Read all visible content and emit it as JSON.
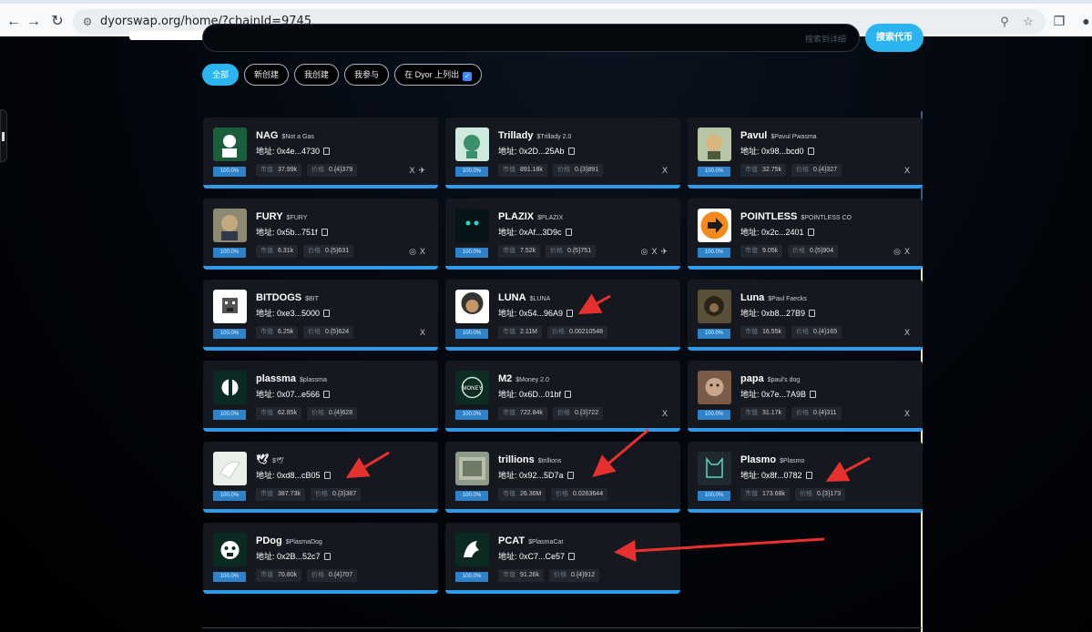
{
  "browser": {
    "url": "dyorswap.org/home/?chainId=9745"
  },
  "search": {
    "placeholder": "搜索到详细",
    "button_label": "搜索代币"
  },
  "filters": [
    {
      "label": "全部",
      "active": true
    },
    {
      "label": "新创建",
      "active": false
    },
    {
      "label": "我创建",
      "active": false
    },
    {
      "label": "我参与",
      "active": false
    },
    {
      "label": "在 Dyor 上列出",
      "active": false,
      "checked": true
    }
  ],
  "labels": {
    "address_prefix": "地址: ",
    "market_cap": "市值",
    "price": "价格"
  },
  "tokens": [
    {
      "name": "NAG",
      "ticker": "$Not a Gas",
      "address": "0x4e...4730",
      "progress": "100.0%",
      "market_cap": "37.99k",
      "price": "0.{4}379",
      "socials": [
        "x",
        "telegram"
      ]
    },
    {
      "name": "Trillady",
      "ticker": "$Trillady 2.0",
      "address": "0x2D...25Ab",
      "progress": "100.0%",
      "market_cap": "891.18k",
      "price": "0.{3}891",
      "socials": [
        "x"
      ]
    },
    {
      "name": "Pavul",
      "ticker": "$Pavul Pwasma",
      "address": "0x98...bcd0",
      "progress": "100.0%",
      "market_cap": "32.75k",
      "price": "0.{4}327",
      "socials": [
        "x"
      ]
    },
    {
      "name": "FURY",
      "ticker": "$FURY",
      "address": "0x5b...751f",
      "progress": "100.0%",
      "market_cap": "6.31k",
      "price": "0.{5}631",
      "socials": [
        "web",
        "x"
      ]
    },
    {
      "name": "PLAZIX",
      "ticker": "$PLAZIX",
      "address": "0xAf...3D9c",
      "progress": "100.0%",
      "market_cap": "7.52k",
      "price": "0.{5}751",
      "socials": [
        "web",
        "x",
        "telegram"
      ]
    },
    {
      "name": "POINTLESS",
      "ticker": "$POINTLESS CO",
      "address": "0x2c...2401",
      "progress": "100.0%",
      "market_cap": "9.05k",
      "price": "0.{5}904",
      "socials": [
        "web",
        "x"
      ]
    },
    {
      "name": "BITDOGS",
      "ticker": "$BIT",
      "address": "0xe3...5000",
      "progress": "100.0%",
      "market_cap": "6.25k",
      "price": "0.{5}624",
      "socials": [
        "x"
      ]
    },
    {
      "name": "LUNA",
      "ticker": "$LUNA",
      "address": "0x54...96A9",
      "progress": "100.0%",
      "market_cap": "2.11M",
      "price": "0.00210548",
      "socials": []
    },
    {
      "name": "Luna",
      "ticker": "$Paul Faecks",
      "address": "0xb8...27B9",
      "progress": "100.0%",
      "market_cap": "16.55k",
      "price": "0.{4}165",
      "socials": [
        "x"
      ]
    },
    {
      "name": "plassma",
      "ticker": "$plassma",
      "address": "0x07...e566",
      "progress": "100.0%",
      "market_cap": "62.85k",
      "price": "0.{4}628",
      "socials": []
    },
    {
      "name": "M2",
      "ticker": "$Money 2.0",
      "address": "0x6D...01bf",
      "progress": "100.0%",
      "market_cap": "722.84k",
      "price": "0.{3}722",
      "socials": [
        "x"
      ]
    },
    {
      "name": "papa",
      "ticker": "$paul's dog",
      "address": "0x7e...7A9B",
      "progress": "100.0%",
      "market_cap": "31.17k",
      "price": "0.{4}311",
      "socials": [
        "x"
      ]
    },
    {
      "name": "🕊",
      "ticker": "$🕊",
      "address": "0xd8...cB05",
      "progress": "100.0%",
      "market_cap": "387.73k",
      "price": "0.{3}387",
      "socials": []
    },
    {
      "name": "trillions",
      "ticker": "$trillions",
      "address": "0x92...5D7a",
      "progress": "100.0%",
      "market_cap": "26.36M",
      "price": "0.0263644",
      "socials": []
    },
    {
      "name": "Plasmo",
      "ticker": "$Plasmo",
      "address": "0x8f...0782",
      "progress": "100.0%",
      "market_cap": "173.68k",
      "price": "0.{3}173",
      "socials": []
    },
    {
      "name": "PDog",
      "ticker": "$PlasmaDog",
      "address": "0x2B...52c7",
      "progress": "100.0%",
      "market_cap": "70.80k",
      "price": "0.{4}707",
      "socials": []
    },
    {
      "name": "PCAT",
      "ticker": "$PlasmaCat",
      "address": "0xC7...Ce57",
      "progress": "100.0%",
      "market_cap": "91.26k",
      "price": "0.{4}912",
      "socials": []
    }
  ],
  "colors": {
    "accent": "#2ab5f0",
    "card_bg": "#15191f",
    "progress_bar": "#2d9bea",
    "annotation_arrow": "#e8312f"
  }
}
